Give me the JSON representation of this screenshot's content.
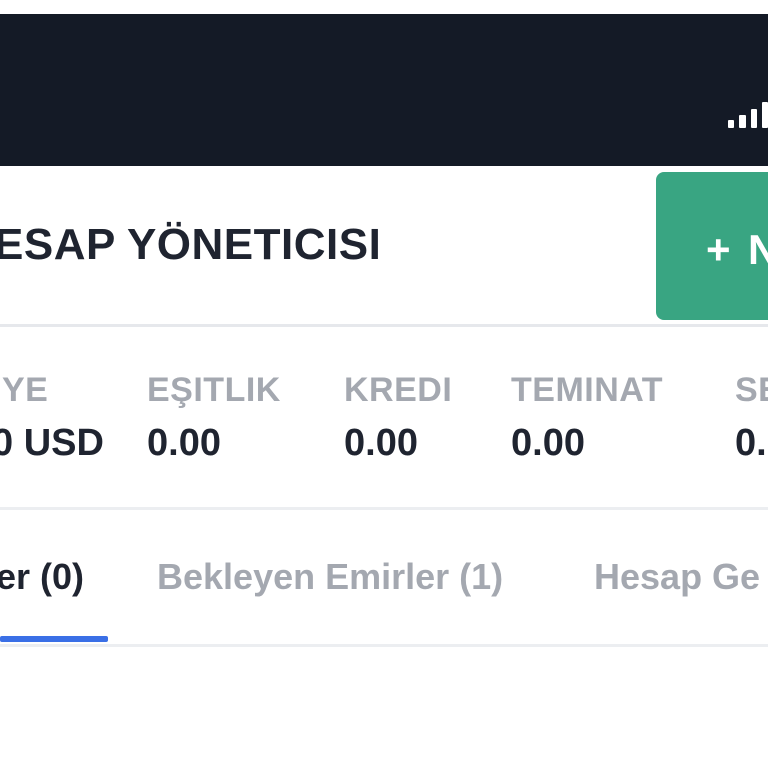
{
  "status_bar": {
    "signal_icon": "signal-bars-icon"
  },
  "header": {
    "title": "ESAP YÖNETICISI",
    "new_button": {
      "plus": "+",
      "label": "N"
    },
    "accent_color": "#39a582"
  },
  "stats": [
    {
      "label": "IYE",
      "value": "0 USD"
    },
    {
      "label": "EŞITLIK",
      "value": "0.00"
    },
    {
      "label": "KREDI",
      "value": "0.00"
    },
    {
      "label": "TEMINAT",
      "value": "0.00"
    },
    {
      "label": "SE",
      "value": "0."
    }
  ],
  "tabs": [
    {
      "label": "er (0)",
      "active": true
    },
    {
      "label": "Bekleyen Emirler (1)",
      "active": false
    },
    {
      "label": "Hesap Ge",
      "active": false
    }
  ],
  "tab_indicator_color": "#3a6fe6"
}
